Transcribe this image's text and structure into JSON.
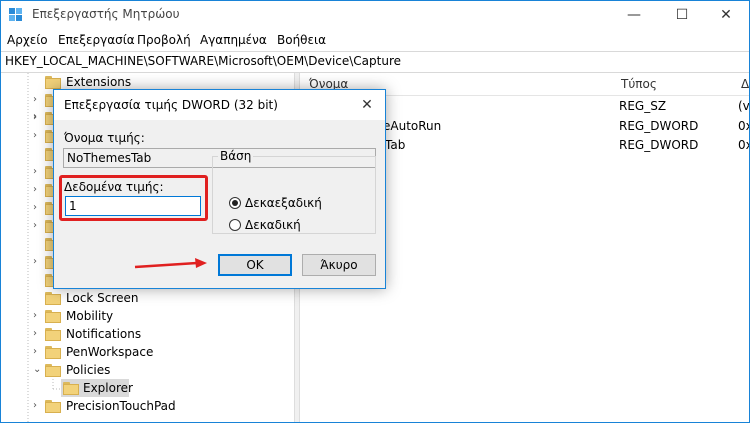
{
  "window": {
    "title": "Επεξεργαστής Μητρώου",
    "minimize": "—",
    "maximize": "☐",
    "close": "✕"
  },
  "menu": [
    "Αρχείο",
    "Επεξεργασία",
    "Προβολή",
    "Αγαπημένα",
    "Βοήθεια"
  ],
  "address": "HKEY_LOCAL_MACHINE\\SOFTWARE\\Microsoft\\OEM\\Device\\Capture",
  "tree": {
    "items": [
      {
        "label": "Extensions"
      },
      {
        "label": "Lock Screen"
      },
      {
        "label": "Mobility"
      },
      {
        "label": "Notifications"
      },
      {
        "label": "PenWorkspace"
      },
      {
        "label": "Policies"
      },
      {
        "label": "Explorer"
      },
      {
        "label": "PrecisionTouchPad"
      }
    ]
  },
  "list": {
    "columns": [
      "Όνομα",
      "Τύπος",
      "Δ"
    ],
    "rows": [
      {
        "name": "",
        "type": "REG_SZ",
        "data": "(v"
      },
      {
        "name": "eAutoRun",
        "type": "REG_DWORD",
        "data": "0x"
      },
      {
        "name": "Tab",
        "type": "REG_DWORD",
        "data": "0x"
      }
    ]
  },
  "dialog": {
    "title": "Επεξεργασία τιμής DWORD (32 bit)",
    "close": "✕",
    "name_label": "Όνομα τιμής:",
    "name_value": "NoThemesTab",
    "data_label": "Δεδομένα τιμής:",
    "data_value": "1",
    "base_label": "Βάση",
    "hex_label": "Δεκαεξαδική",
    "dec_label": "Δεκαδική",
    "ok_label": "OK",
    "cancel_label": "Άκυρο"
  },
  "colors": {
    "accent": "#0078d7",
    "highlight": "#e02020"
  }
}
